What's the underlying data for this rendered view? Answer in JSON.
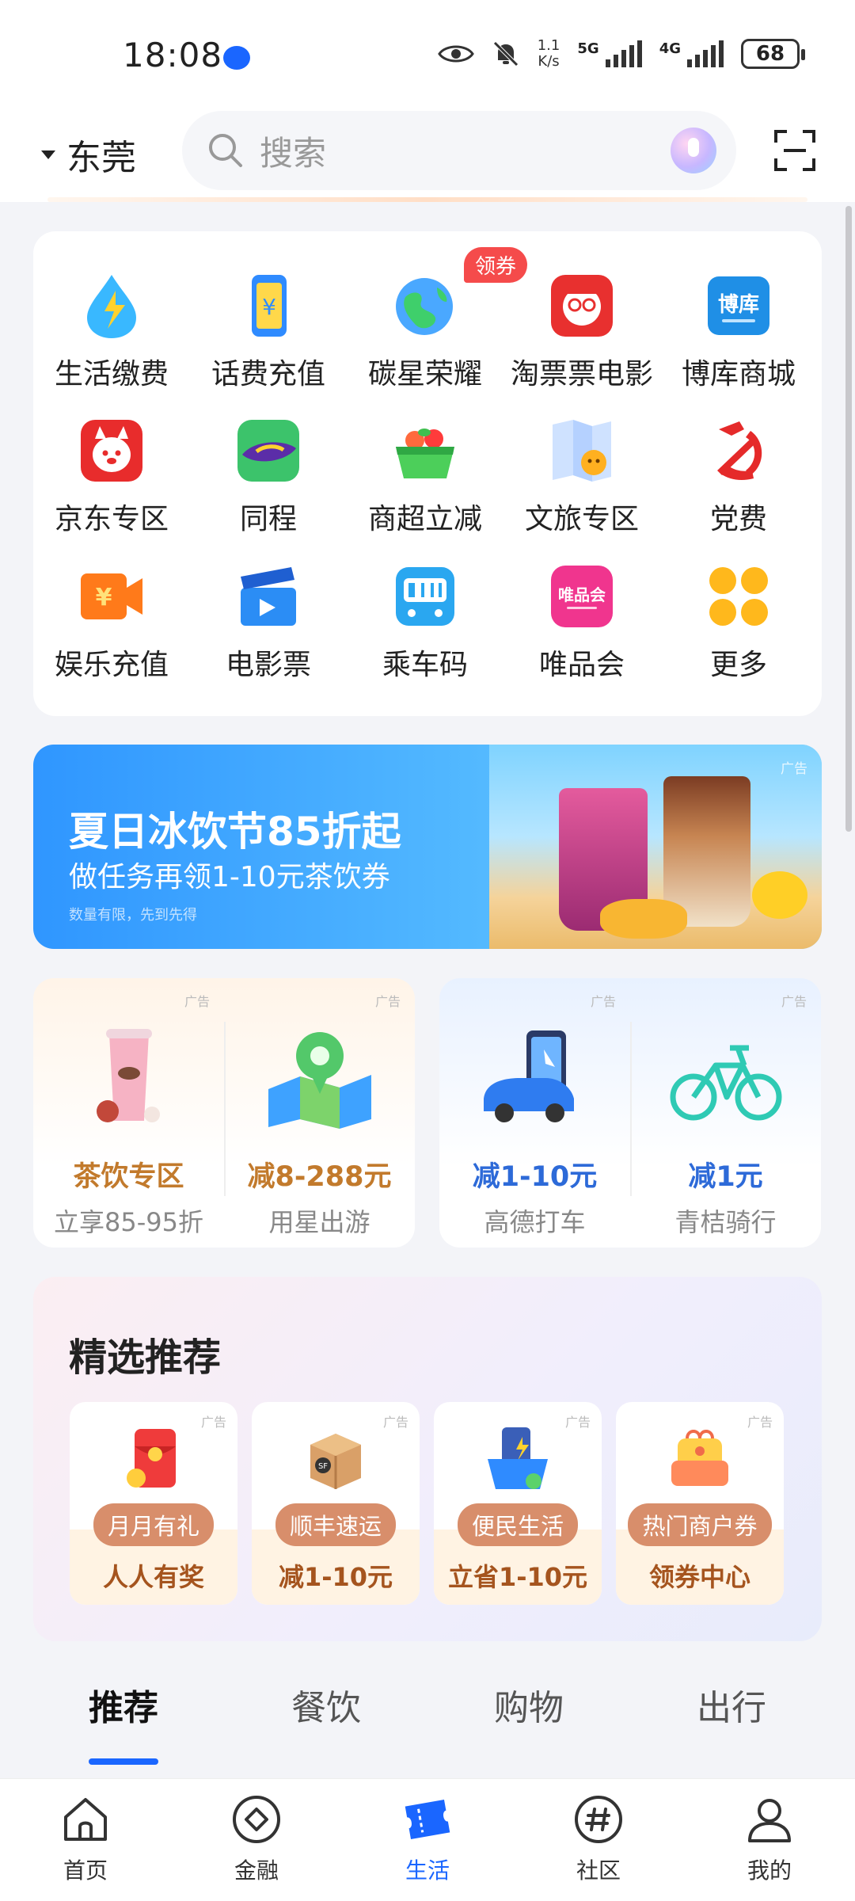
{
  "status_bar": {
    "time": "18:08",
    "net_speed_value": "1.1",
    "net_speed_unit": "K/s",
    "signal1_label": "5G",
    "signal2_label": "4G",
    "battery": "68"
  },
  "header": {
    "city": "东莞",
    "search_placeholder": "搜索"
  },
  "services": {
    "items": [
      {
        "label": "生活缴费",
        "icon": "utility-bill-icon"
      },
      {
        "label": "话费充值",
        "icon": "phone-topup-icon"
      },
      {
        "label": "碳星荣耀",
        "icon": "earth-icon",
        "badge": "领券"
      },
      {
        "label": "淘票票电影",
        "icon": "taopiaopiao-icon"
      },
      {
        "label": "博库商城",
        "icon": "bookstore-icon"
      },
      {
        "label": "京东专区",
        "icon": "jd-icon"
      },
      {
        "label": "同程",
        "icon": "tongcheng-icon"
      },
      {
        "label": "商超立减",
        "icon": "supermarket-basket-icon"
      },
      {
        "label": "文旅专区",
        "icon": "travel-map-icon"
      },
      {
        "label": "党费",
        "icon": "party-emblem-icon"
      },
      {
        "label": "娱乐充值",
        "icon": "entertainment-topup-icon"
      },
      {
        "label": "电影票",
        "icon": "clapperboard-icon"
      },
      {
        "label": "乘车码",
        "icon": "transit-qrcode-icon"
      },
      {
        "label": "唯品会",
        "icon": "vipshop-icon"
      },
      {
        "label": "更多",
        "icon": "more-grid-icon"
      }
    ],
    "vipshop_logo_text": "唯品会"
  },
  "banner": {
    "title": "夏日冰饮节85折起",
    "subtitle": "做任务再领1-10元茶饮券",
    "note": "数量有限，先到先得",
    "ad": "广告"
  },
  "promos": {
    "ad": "广告",
    "items": [
      {
        "title": "茶饮专区",
        "sub": "立享85-95折",
        "color": "#c27a2c"
      },
      {
        "title": "减8-288元",
        "sub": "用星出游",
        "color": "#c27a2c"
      },
      {
        "title": "减1-10元",
        "sub": "高德打车",
        "color": "#2d6ad8"
      },
      {
        "title": "减1元",
        "sub": "青桔骑行",
        "color": "#2d6ad8"
      }
    ]
  },
  "recommend": {
    "title": "精选推荐",
    "ad": "广告",
    "items": [
      {
        "pill": "月月有礼",
        "sub": "人人有奖"
      },
      {
        "pill": "顺丰速运",
        "sub": "减1-10元"
      },
      {
        "pill": "便民生活",
        "sub": "立省1-10元"
      },
      {
        "pill": "热门商户券",
        "sub": "领券中心"
      }
    ]
  },
  "category_tabs": [
    "推荐",
    "餐饮",
    "购物",
    "出行"
  ],
  "bottom_nav": [
    {
      "label": "首页",
      "icon": "home-icon"
    },
    {
      "label": "金融",
      "icon": "finance-diamond-icon"
    },
    {
      "label": "生活",
      "icon": "life-ticket-icon",
      "active": true
    },
    {
      "label": "社区",
      "icon": "community-hash-icon"
    },
    {
      "label": "我的",
      "icon": "profile-icon"
    }
  ],
  "colors": {
    "accent": "#1a66ff",
    "badge": "#f54b4b"
  }
}
